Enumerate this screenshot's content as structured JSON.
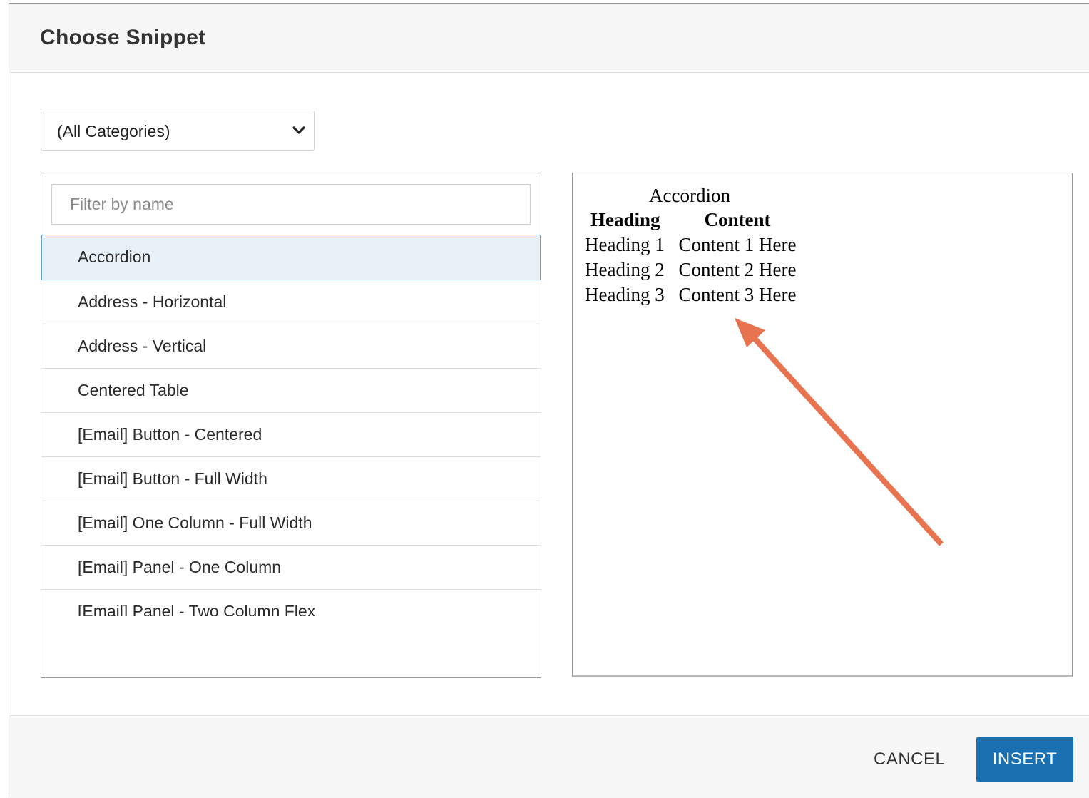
{
  "dialog": {
    "title": "Choose Snippet"
  },
  "category_select": {
    "value": "(All Categories)"
  },
  "filter": {
    "placeholder": "Filter by name",
    "value": ""
  },
  "snippets": [
    {
      "label": "Accordion",
      "selected": true
    },
    {
      "label": "Address - Horizontal",
      "selected": false
    },
    {
      "label": "Address - Vertical",
      "selected": false
    },
    {
      "label": "Centered Table",
      "selected": false
    },
    {
      "label": "[Email] Button - Centered",
      "selected": false
    },
    {
      "label": "[Email] Button - Full Width",
      "selected": false
    },
    {
      "label": "[Email] One Column - Full Width",
      "selected": false
    },
    {
      "label": "[Email] Panel - One Column",
      "selected": false
    },
    {
      "label": "[Email] Panel - Two Column Flex",
      "selected": false
    }
  ],
  "preview": {
    "caption": "Accordion",
    "headers": [
      "Heading",
      "Content"
    ],
    "rows": [
      [
        "Heading 1",
        "Content 1 Here"
      ],
      [
        "Heading 2",
        "Content 2 Here"
      ],
      [
        "Heading 3",
        "Content 3 Here"
      ]
    ]
  },
  "annotation": {
    "arrow_color": "#e8734f"
  },
  "footer": {
    "cancel_label": "CANCEL",
    "insert_label": "INSERT"
  },
  "colors": {
    "primary": "#1a6fb0",
    "selected_bg": "#e9f1f8",
    "selected_border": "#6aa3cb"
  }
}
